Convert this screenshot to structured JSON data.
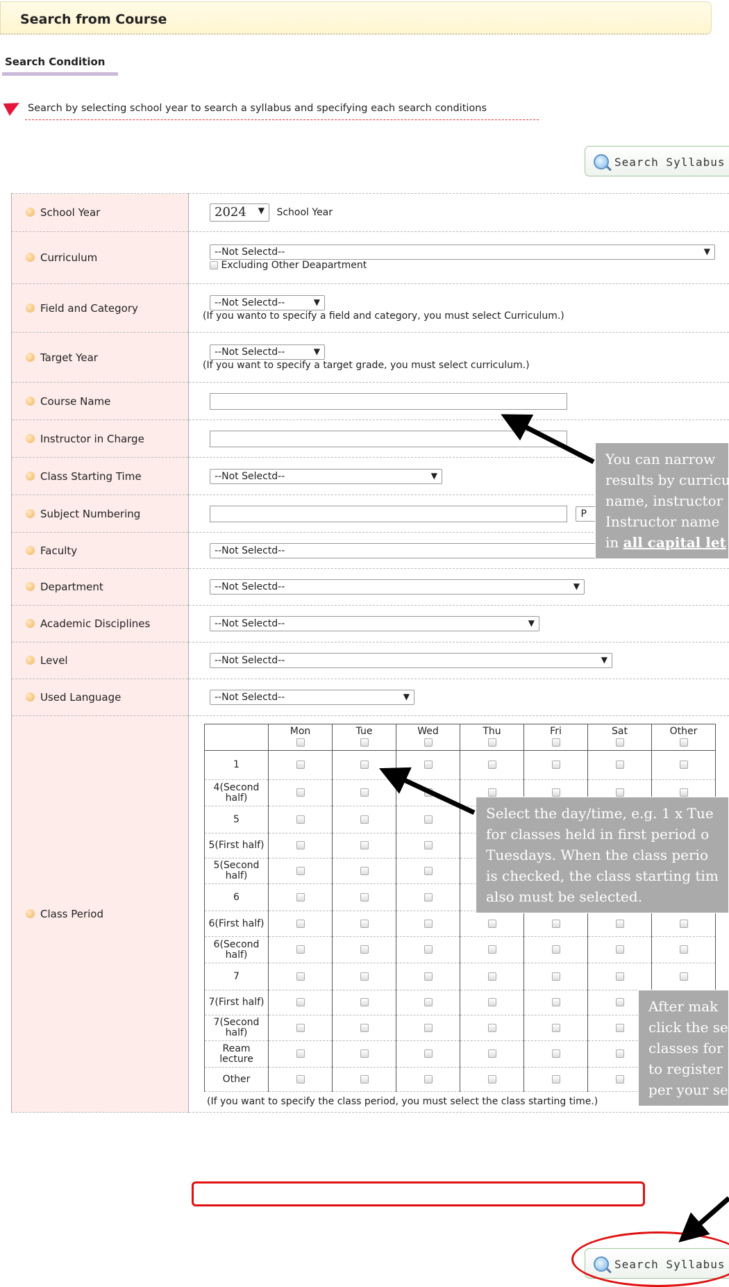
{
  "header": {
    "title": "Search from Course"
  },
  "condition": {
    "title": "Search Condition",
    "intro": "Search by selecting school year to search a syllabus and specifying each search conditions"
  },
  "search_button_label": "Search Syllabus",
  "fields": {
    "school_year": {
      "label": "School Year",
      "value": "2024",
      "suffix": "School Year"
    },
    "curriculum": {
      "label": "Curriculum",
      "value": "--Not Selectd--",
      "exclude_label": "Excluding Other Deapartment"
    },
    "field_category": {
      "label": "Field and Category",
      "value": "--Not Selectd--",
      "note": "(If you wanto to specify a field and category, you must select Curriculum.)"
    },
    "target_year": {
      "label": "Target Year",
      "value": "--Not Selectd--",
      "note": "(If you want to specify a target grade, you must select curriculum.)"
    },
    "course_name": {
      "label": "Course Name",
      "value": ""
    },
    "instructor": {
      "label": "Instructor in Charge",
      "value": ""
    },
    "start_time": {
      "label": "Class Starting Time",
      "value": "--Not Selectd--"
    },
    "subject_numbering": {
      "label": "Subject Numbering",
      "value": "",
      "extra": "P"
    },
    "faculty": {
      "label": "Faculty",
      "value": "--Not Selectd--"
    },
    "department": {
      "label": "Department",
      "value": "--Not Selectd--"
    },
    "academic_disciplines": {
      "label": "Academic Disciplines",
      "value": "--Not Selectd--"
    },
    "level": {
      "label": "Level",
      "value": "--Not Selectd--"
    },
    "used_language": {
      "label": "Used Language",
      "value": "--Not Selectd--"
    }
  },
  "class_period": {
    "label": "Class Period",
    "days": [
      "Mon",
      "Tue",
      "Wed",
      "Thu",
      "Fri",
      "Sat",
      "Other"
    ],
    "rows": [
      "1",
      "4(Second half)",
      "5",
      "5(First half)",
      "5(Second half)",
      "6",
      "6(First half)",
      "6(Second half)",
      "7",
      "7(First half)",
      "7(Second half)",
      "Ream lecture",
      "Other"
    ],
    "note": "(If you want to specify the class period, you must select the class starting time.)"
  },
  "callouts": {
    "narrow": [
      "You can narrow",
      "results by curricu",
      "name, instructor",
      "Instructor name",
      "in "
    ],
    "narrow_bold": "all capital let",
    "period": [
      "Select the day/time, e.g. 1 x Tue",
      "for classes held in first period o",
      "Tuesdays. When the class perio",
      "is checked, the class starting tim",
      "also must be selected."
    ],
    "after": [
      "After mak",
      "click the se",
      "classes for",
      "to register",
      "per your se"
    ]
  }
}
